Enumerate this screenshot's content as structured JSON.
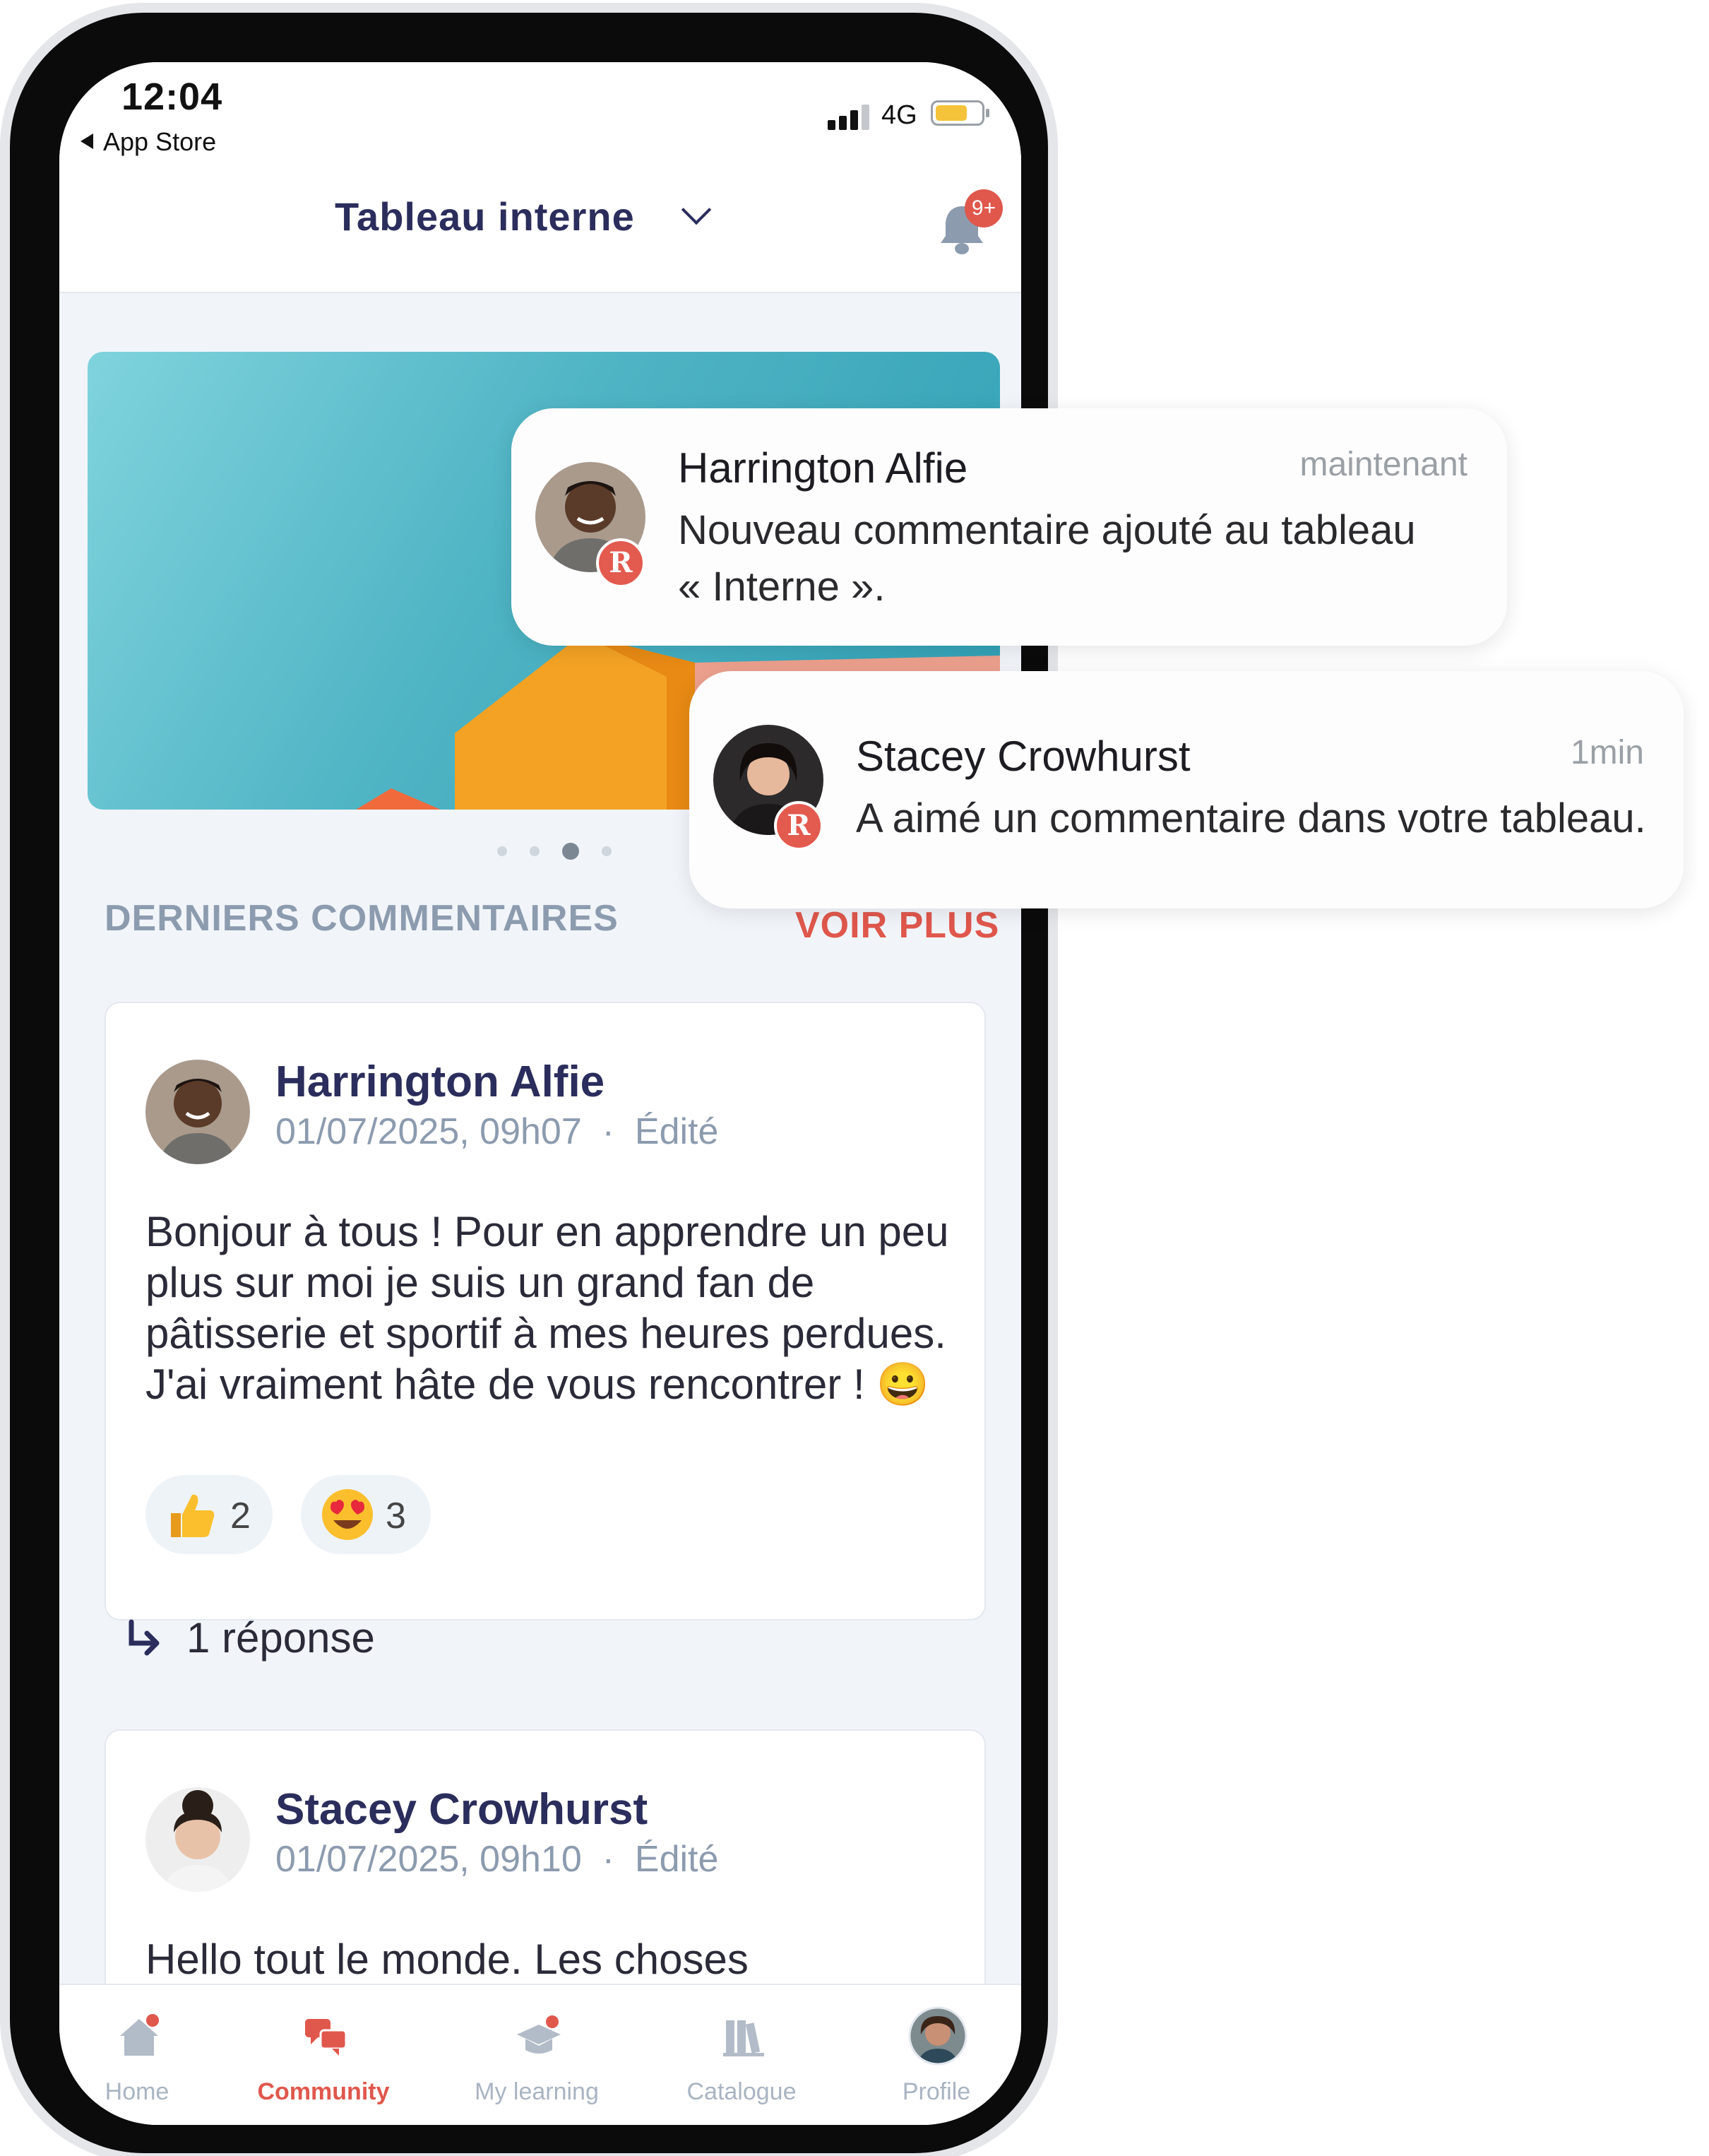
{
  "status_bar": {
    "time": "12:04",
    "back_label": "App Store",
    "network": "4G"
  },
  "header": {
    "board_title": "Tableau interne",
    "notification_badge": "9+"
  },
  "carousel": {
    "page_count": 4,
    "active_index": 2
  },
  "section": {
    "title": "DERNIERS COMMENTAIRES",
    "see_more": "VOIR PLUS"
  },
  "comments": [
    {
      "author": "Harrington Alfie",
      "date": "01/07/2025, 09h07",
      "separator": "·",
      "edited": "Édité",
      "body": "Bonjour à tous ! Pour en apprendre un peu plus sur moi je suis un grand fan de pâtisserie et sportif à mes heures perdues. J'ai vraiment hâte de vous rencontrer ! 😀",
      "reactions": [
        {
          "icon": "thumbs-up-icon",
          "count": "2"
        },
        {
          "icon": "heart-eyes-icon",
          "count": "3"
        }
      ]
    },
    {
      "author": "Stacey Crowhurst",
      "date": "01/07/2025, 09h10",
      "separator": "·",
      "edited": "Édité",
      "body": "Hello tout le monde. Les choses"
    }
  ],
  "replies": {
    "label": "1 réponse"
  },
  "tabbar": [
    {
      "label": "Home",
      "icon": "home-icon"
    },
    {
      "label": "Community",
      "icon": "community-icon",
      "active": true
    },
    {
      "label": "My learning",
      "icon": "graduation-cap-icon"
    },
    {
      "label": "Catalogue",
      "icon": "books-icon"
    },
    {
      "label": "Profile",
      "icon": "profile-avatar"
    }
  ],
  "notifications": [
    {
      "name": "Harrington Alfie",
      "time": "maintenant",
      "line1": "Nouveau commentaire ajouté au tableau",
      "line2": "« Interne »."
    },
    {
      "name": "Stacey Crowhurst",
      "time": "1min",
      "line1": "A aimé un commentaire dans votre tableau."
    }
  ],
  "colors": {
    "accent": "#e0574c",
    "title": "#2b2d5c",
    "muted": "#8c9bae",
    "background": "#f1f5fa"
  }
}
